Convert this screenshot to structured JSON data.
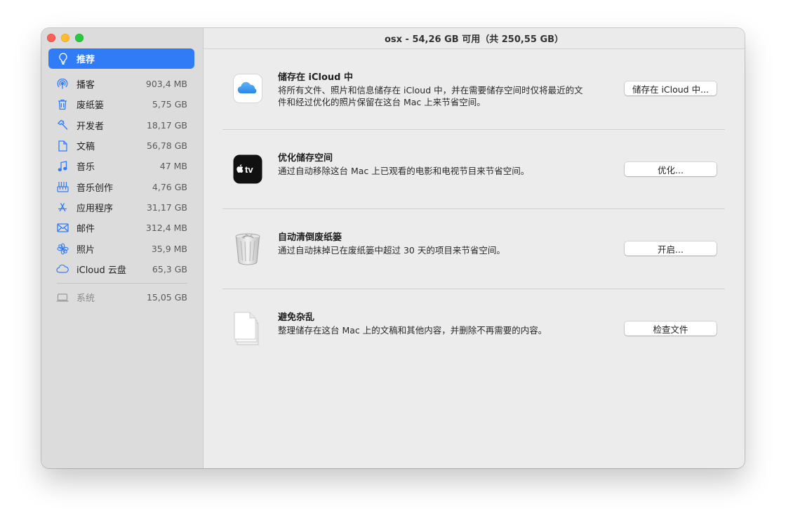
{
  "window": {
    "title": "osx - 54,26 GB 可用（共 250,55 GB）"
  },
  "sidebar": {
    "selected": {
      "label": "推荐",
      "icon": "lightbulb-icon"
    },
    "items": [
      {
        "label": "播客",
        "size": "903,4 MB",
        "icon": "podcast-icon"
      },
      {
        "label": "废纸篓",
        "size": "5,75 GB",
        "icon": "trash-icon"
      },
      {
        "label": "开发者",
        "size": "18,17 GB",
        "icon": "hammer-icon"
      },
      {
        "label": "文稿",
        "size": "56,78 GB",
        "icon": "document-icon"
      },
      {
        "label": "音乐",
        "size": "47 MB",
        "icon": "music-note-icon"
      },
      {
        "label": "音乐创作",
        "size": "4,76 GB",
        "icon": "music-creation-icon"
      },
      {
        "label": "应用程序",
        "size": "31,17 GB",
        "icon": "app-store-icon"
      },
      {
        "label": "邮件",
        "size": "312,4 MB",
        "icon": "envelope-icon"
      },
      {
        "label": "照片",
        "size": "35,9 MB",
        "icon": "photos-flower-icon"
      },
      {
        "label": "iCloud 云盘",
        "size": "65,3 GB",
        "icon": "cloud-icon"
      }
    ],
    "system": {
      "label": "系统",
      "size": "15,05 GB",
      "icon": "laptop-icon"
    }
  },
  "recommendations": [
    {
      "title": "储存在 iCloud 中",
      "desc_line1": "将所有文件、照片和信息储存在 iCloud 中，并在需要储存空间时仅将最近的文",
      "desc_line2": "件和经过优化的照片保留在这台 Mac 上来节省空间。",
      "button": "储存在 iCloud 中...",
      "icon": "icloud-app-icon"
    },
    {
      "title": "优化储存空间",
      "desc_line1": "通过自动移除这台 Mac 上已观看的电影和电视节目来节省空间。",
      "button": "优化...",
      "icon": "apple-tv-app-icon",
      "icon_text": "tv"
    },
    {
      "title": "自动清倒废纸篓",
      "desc_line1": "通过自动抹掉已在废纸篓中超过 30 天的项目来节省空间。",
      "button": "开启...",
      "icon": "trash-can-icon"
    },
    {
      "title": "避免杂乱",
      "desc_line1": "整理储存在这台 Mac 上的文稿和其他内容，并删除不再需要的内容。",
      "button": "检查文件",
      "icon": "documents-stack-icon"
    }
  ],
  "colors": {
    "accent": "#2f7cf6",
    "sidebar_bg": "#dddcdc",
    "main_bg": "#ececec",
    "close": "#ff5f57",
    "minimize": "#febc2e",
    "zoom": "#28c840"
  }
}
